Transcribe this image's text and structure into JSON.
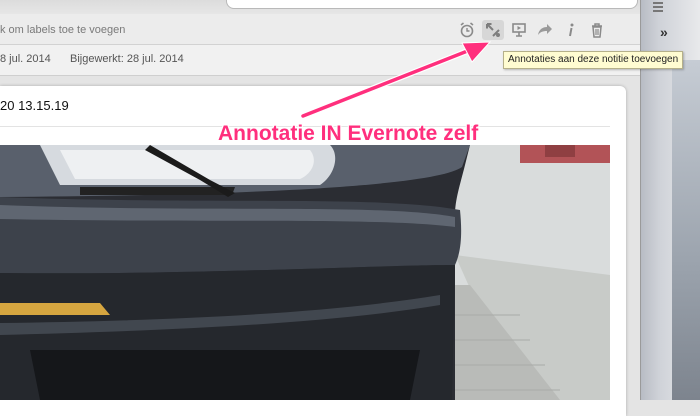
{
  "tags": {
    "hint": "k om labels toe te voegen"
  },
  "meta": {
    "created": "8 jul. 2014",
    "updated": "Bijgewerkt: 28 jul. 2014"
  },
  "toolbar": {
    "items": [
      "reminder-alarm",
      "annotate",
      "presentation",
      "share",
      "info",
      "delete"
    ],
    "tooltip": "Annotaties aan deze notitie toevoegen"
  },
  "sidepanel": {
    "expand_glyph": "»"
  },
  "note": {
    "title": "20 13.15.19"
  },
  "annotation": {
    "text": "Annotatie IN Evernote zelf",
    "color": "#ff2f7d"
  }
}
